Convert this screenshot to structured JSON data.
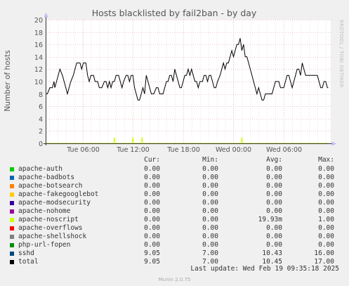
{
  "watermark": "RRDTOOL / TOBI OETIKER",
  "chart_data": {
    "type": "line",
    "title": "Hosts blacklisted by fail2ban - by day",
    "ylabel": "Number of hosts",
    "ylim": [
      0,
      20
    ],
    "yticks": [
      0,
      2,
      4,
      6,
      8,
      10,
      12,
      14,
      16,
      18,
      20
    ],
    "xticks": [
      "Tue 06:00",
      "Tue 12:00",
      "Tue 18:00",
      "Wed 00:00",
      "Wed 06:00"
    ],
    "xtick_hours": [
      6,
      12,
      18,
      24,
      30
    ],
    "x_range_hours": [
      1.6,
      35.6
    ],
    "grid": true,
    "series": [
      {
        "name": "total",
        "color": "#000000",
        "points": [
          [
            1.6,
            8
          ],
          [
            1.8,
            8
          ],
          [
            2.1,
            9
          ],
          [
            2.4,
            9
          ],
          [
            2.6,
            10
          ],
          [
            2.7,
            9
          ],
          [
            2.9,
            10
          ],
          [
            3.1,
            11
          ],
          [
            3.3,
            12
          ],
          [
            3.6,
            11
          ],
          [
            3.8,
            10
          ],
          [
            4.0,
            9
          ],
          [
            4.2,
            8
          ],
          [
            4.4,
            9
          ],
          [
            4.6,
            10
          ],
          [
            4.9,
            11
          ],
          [
            5.1,
            12
          ],
          [
            5.3,
            13
          ],
          [
            5.7,
            13
          ],
          [
            5.9,
            12
          ],
          [
            6.1,
            13
          ],
          [
            6.4,
            13
          ],
          [
            6.6,
            11
          ],
          [
            6.8,
            10
          ],
          [
            7.0,
            11
          ],
          [
            7.3,
            11
          ],
          [
            7.5,
            10
          ],
          [
            7.8,
            10
          ],
          [
            8.0,
            9
          ],
          [
            8.3,
            9
          ],
          [
            8.6,
            10
          ],
          [
            8.8,
            10
          ],
          [
            9.0,
            9
          ],
          [
            9.2,
            10
          ],
          [
            9.4,
            9
          ],
          [
            9.6,
            10
          ],
          [
            9.8,
            10
          ],
          [
            10.0,
            11
          ],
          [
            10.3,
            11
          ],
          [
            10.5,
            10
          ],
          [
            10.7,
            9
          ],
          [
            10.9,
            10
          ],
          [
            11.2,
            11
          ],
          [
            11.4,
            11
          ],
          [
            11.6,
            10
          ],
          [
            11.8,
            11
          ],
          [
            12.0,
            11
          ],
          [
            12.2,
            9
          ],
          [
            12.4,
            8
          ],
          [
            12.6,
            7
          ],
          [
            12.8,
            7
          ],
          [
            13.0,
            8
          ],
          [
            13.2,
            9
          ],
          [
            13.4,
            8
          ],
          [
            13.6,
            11
          ],
          [
            13.8,
            10
          ],
          [
            14.0,
            9
          ],
          [
            14.2,
            8
          ],
          [
            14.5,
            8
          ],
          [
            14.8,
            9
          ],
          [
            15.0,
            9
          ],
          [
            15.2,
            8
          ],
          [
            15.4,
            8
          ],
          [
            15.6,
            8
          ],
          [
            15.8,
            9
          ],
          [
            16.0,
            10
          ],
          [
            16.2,
            10
          ],
          [
            16.4,
            11
          ],
          [
            16.6,
            11
          ],
          [
            16.8,
            10
          ],
          [
            17.0,
            12
          ],
          [
            17.2,
            11
          ],
          [
            17.4,
            10
          ],
          [
            17.6,
            9
          ],
          [
            17.8,
            9
          ],
          [
            18.0,
            10
          ],
          [
            18.2,
            11
          ],
          [
            18.4,
            11
          ],
          [
            18.6,
            12
          ],
          [
            18.8,
            11
          ],
          [
            19.0,
            12
          ],
          [
            19.2,
            11
          ],
          [
            19.4,
            10
          ],
          [
            19.6,
            10
          ],
          [
            19.8,
            9
          ],
          [
            20.0,
            10
          ],
          [
            20.3,
            10
          ],
          [
            20.5,
            11
          ],
          [
            20.7,
            11
          ],
          [
            20.9,
            10
          ],
          [
            21.1,
            11
          ],
          [
            21.3,
            11
          ],
          [
            21.5,
            10
          ],
          [
            21.7,
            9
          ],
          [
            21.9,
            9
          ],
          [
            22.1,
            10
          ],
          [
            22.4,
            11
          ],
          [
            22.6,
            12
          ],
          [
            22.8,
            13
          ],
          [
            23.0,
            12
          ],
          [
            23.2,
            13
          ],
          [
            23.4,
            13
          ],
          [
            23.6,
            14
          ],
          [
            23.8,
            15
          ],
          [
            24.0,
            14
          ],
          [
            24.2,
            15
          ],
          [
            24.4,
            16
          ],
          [
            24.6,
            16
          ],
          [
            24.8,
            17
          ],
          [
            25.0,
            15
          ],
          [
            25.2,
            16
          ],
          [
            25.4,
            14
          ],
          [
            25.6,
            14
          ],
          [
            25.8,
            13
          ],
          [
            26.0,
            12
          ],
          [
            26.2,
            11
          ],
          [
            26.4,
            10
          ],
          [
            26.6,
            9
          ],
          [
            26.8,
            8
          ],
          [
            27.0,
            9
          ],
          [
            27.2,
            8
          ],
          [
            27.4,
            7
          ],
          [
            27.6,
            7
          ],
          [
            27.8,
            8
          ],
          [
            28.0,
            8
          ],
          [
            28.3,
            8
          ],
          [
            28.6,
            8
          ],
          [
            28.8,
            9
          ],
          [
            29.0,
            10
          ],
          [
            29.2,
            10
          ],
          [
            29.4,
            10
          ],
          [
            29.6,
            9
          ],
          [
            29.8,
            9
          ],
          [
            30.0,
            9
          ],
          [
            30.2,
            10
          ],
          [
            30.4,
            11
          ],
          [
            30.6,
            11
          ],
          [
            30.8,
            10
          ],
          [
            31.0,
            9
          ],
          [
            31.2,
            10
          ],
          [
            31.4,
            11
          ],
          [
            31.6,
            12
          ],
          [
            31.8,
            12
          ],
          [
            32.0,
            11
          ],
          [
            32.2,
            13
          ],
          [
            32.4,
            12
          ],
          [
            32.6,
            11
          ],
          [
            32.8,
            11
          ],
          [
            33.0,
            11
          ],
          [
            33.2,
            11
          ],
          [
            33.4,
            11
          ],
          [
            33.6,
            11
          ],
          [
            33.8,
            11
          ],
          [
            34.0,
            11
          ],
          [
            34.2,
            10
          ],
          [
            34.4,
            9
          ],
          [
            34.6,
            9
          ],
          [
            34.8,
            10
          ],
          [
            35.0,
            10
          ],
          [
            35.2,
            9
          ],
          [
            35.3,
            9
          ]
        ]
      },
      {
        "name": "apache-noscript",
        "color": "#ccff00",
        "points": [
          [
            1.6,
            0
          ],
          [
            9.7,
            0
          ],
          [
            9.8,
            1
          ],
          [
            9.9,
            0
          ],
          [
            11.9,
            0
          ],
          [
            12.0,
            1
          ],
          [
            12.1,
            0
          ],
          [
            13.0,
            0
          ],
          [
            13.1,
            1
          ],
          [
            13.2,
            0
          ],
          [
            24.9,
            0
          ],
          [
            25.0,
            1
          ],
          [
            25.1,
            0
          ],
          [
            35.3,
            0
          ]
        ]
      }
    ]
  },
  "legend": {
    "headers": {
      "cur": "Cur:",
      "min": "Min:",
      "avg": "Avg:",
      "max": "Max:"
    },
    "rows": [
      {
        "name": "apache-auth",
        "color": "#00cc00",
        "cur": "0.00",
        "min": "0.00",
        "avg": "0.00",
        "max": "0.00"
      },
      {
        "name": "apache-badbots",
        "color": "#0066b3",
        "cur": "0.00",
        "min": "0.00",
        "avg": "0.00",
        "max": "0.00"
      },
      {
        "name": "apache-botsearch",
        "color": "#ff8000",
        "cur": "0.00",
        "min": "0.00",
        "avg": "0.00",
        "max": "0.00"
      },
      {
        "name": "apache-fakegooglebot",
        "color": "#ffcc00",
        "cur": "0.00",
        "min": "0.00",
        "avg": "0.00",
        "max": "0.00"
      },
      {
        "name": "apache-modsecurity",
        "color": "#330099",
        "cur": "0.00",
        "min": "0.00",
        "avg": "0.00",
        "max": "0.00"
      },
      {
        "name": "apache-nohome",
        "color": "#990099",
        "cur": "0.00",
        "min": "0.00",
        "avg": "0.00",
        "max": "0.00"
      },
      {
        "name": "apache-noscript",
        "color": "#ccff00",
        "cur": "0.00",
        "min": "0.00",
        "avg": "19.93m",
        "max": "1.00"
      },
      {
        "name": "apache-overflows",
        "color": "#ff0000",
        "cur": "0.00",
        "min": "0.00",
        "avg": "0.00",
        "max": "0.00"
      },
      {
        "name": "apache-shellshock",
        "color": "#808080",
        "cur": "0.00",
        "min": "0.00",
        "avg": "0.00",
        "max": "0.00"
      },
      {
        "name": "php-url-fopen",
        "color": "#008f00",
        "cur": "0.00",
        "min": "0.00",
        "avg": "0.00",
        "max": "0.00"
      },
      {
        "name": "sshd",
        "color": "#00487d",
        "cur": "9.05",
        "min": "7.00",
        "avg": "10.43",
        "max": "16.00"
      },
      {
        "name": "total",
        "color": "#000000",
        "cur": "9.05",
        "min": "7.00",
        "avg": "10.45",
        "max": "17.00"
      }
    ]
  },
  "last_update": "Last update: Wed Feb 19 09:35:18 2025",
  "munin_version": "Munin 2.0.75"
}
